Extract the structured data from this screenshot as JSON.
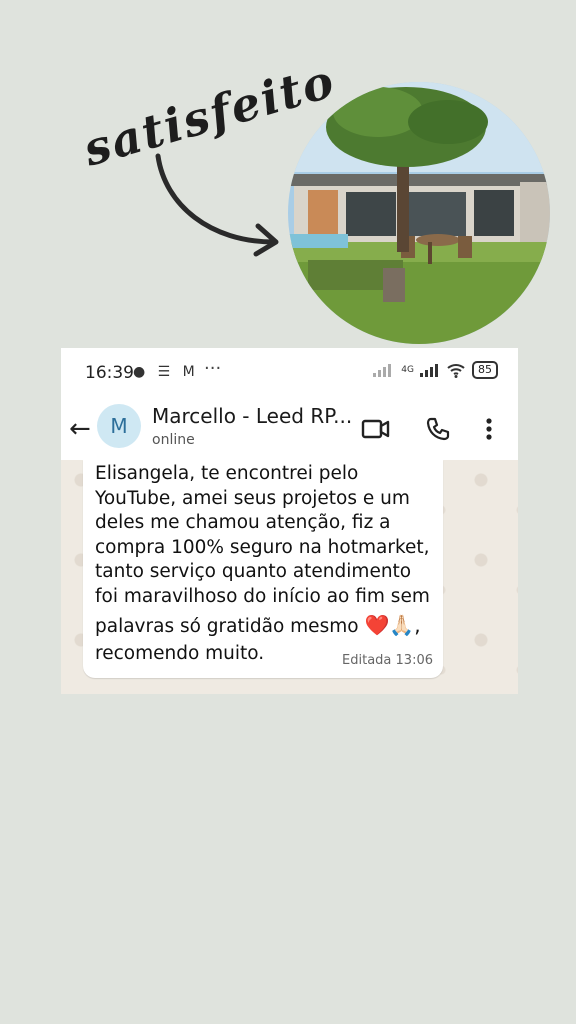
{
  "annotation": {
    "text": "satisfeito"
  },
  "status_bar": {
    "time": "16:39",
    "notif_icons": "● ☰ M",
    "more": "···",
    "network": "4G",
    "battery": "85"
  },
  "chat_header": {
    "back_icon": "←",
    "avatar_letter": "M",
    "contact_name": "Marcello - Leed RP...",
    "status": "online"
  },
  "message": {
    "lines": [
      "Elisangela, te encontrei pelo",
      "YouTube, amei seus projetos e um",
      "deles me chamou atenção, fiz a",
      "compra 100% seguro na hotmarket,",
      "tanto serviço quanto atendimento",
      "foi maravilhoso do início ao fim sem",
      "palavras só gratidão mesmo",
      "recomendo muito."
    ],
    "emojis": "❤️🙏🏻,",
    "edited_label": "Editada 13:06"
  },
  "colors": {
    "background": "#dfe3dd",
    "chat_wallpaper": "#efeae2",
    "avatar_bg": "#cfe8f3"
  }
}
